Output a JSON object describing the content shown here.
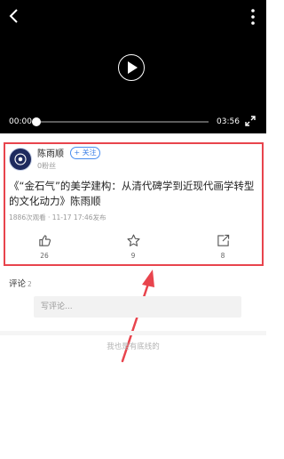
{
  "player": {
    "current_time": "00:00",
    "duration": "03:56",
    "progress": 0,
    "icons": [
      "back-arrow-icon",
      "more-vertical-icon",
      "play-icon",
      "fullscreen-icon"
    ]
  },
  "author": {
    "name": "陈雨顺",
    "fans": "0粉丝",
    "follow_label": "+ 关注"
  },
  "video": {
    "title": "《“金石气”的美学建构：从清代碑学到近现代画学转型的文化动力》陈雨顺",
    "meta": "1886次观看 · 11-17 17:46发布"
  },
  "actions": {
    "like": {
      "count": "26",
      "icon": "thumbs-up-icon"
    },
    "favorite": {
      "count": "9",
      "icon": "star-icon"
    },
    "share": {
      "count": "8",
      "icon": "share-icon"
    }
  },
  "comments": {
    "label": "评论",
    "count": "2",
    "placeholder": "写评论..."
  },
  "footer": {
    "bottom_line": "我也是有底线的"
  },
  "colors": {
    "highlight": "#e8444d",
    "accent": "#3b7fe6",
    "player_bg": "#000000"
  }
}
